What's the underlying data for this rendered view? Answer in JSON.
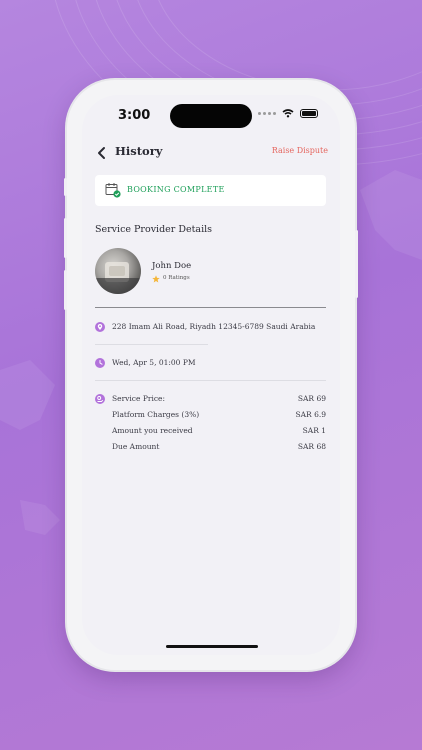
{
  "status_bar": {
    "time": "3:00"
  },
  "header": {
    "title": "History",
    "dispute_label": "Raise Dispute"
  },
  "booking_card": {
    "status": "BOOKING COMPLETE"
  },
  "provider_section": {
    "title": "Service Provider Details",
    "name": "John Doe",
    "ratings": "0 Ratings"
  },
  "address": "228 Imam Ali Road, Riyadh 12345-6789 Saudi Arabia",
  "datetime": "Wed, Apr 5, 01:00 PM",
  "charges": [
    {
      "label": "Service Price:",
      "amount": "SAR 69"
    },
    {
      "label": "Platform Charges (3%)",
      "amount": "SAR 6.9"
    },
    {
      "label": "Amount you received",
      "amount": "SAR 1"
    },
    {
      "label": "Due Amount",
      "amount": "SAR 68"
    }
  ],
  "colors": {
    "accent": "#b272db",
    "success": "#1fa05a",
    "danger": "#e5665f",
    "background": "#a873d8"
  },
  "icons": [
    "back-chevron-icon",
    "calendar-check-icon",
    "star-icon",
    "location-pin-icon",
    "clock-icon",
    "payment-icon",
    "wifi-icon",
    "battery-icon"
  ]
}
